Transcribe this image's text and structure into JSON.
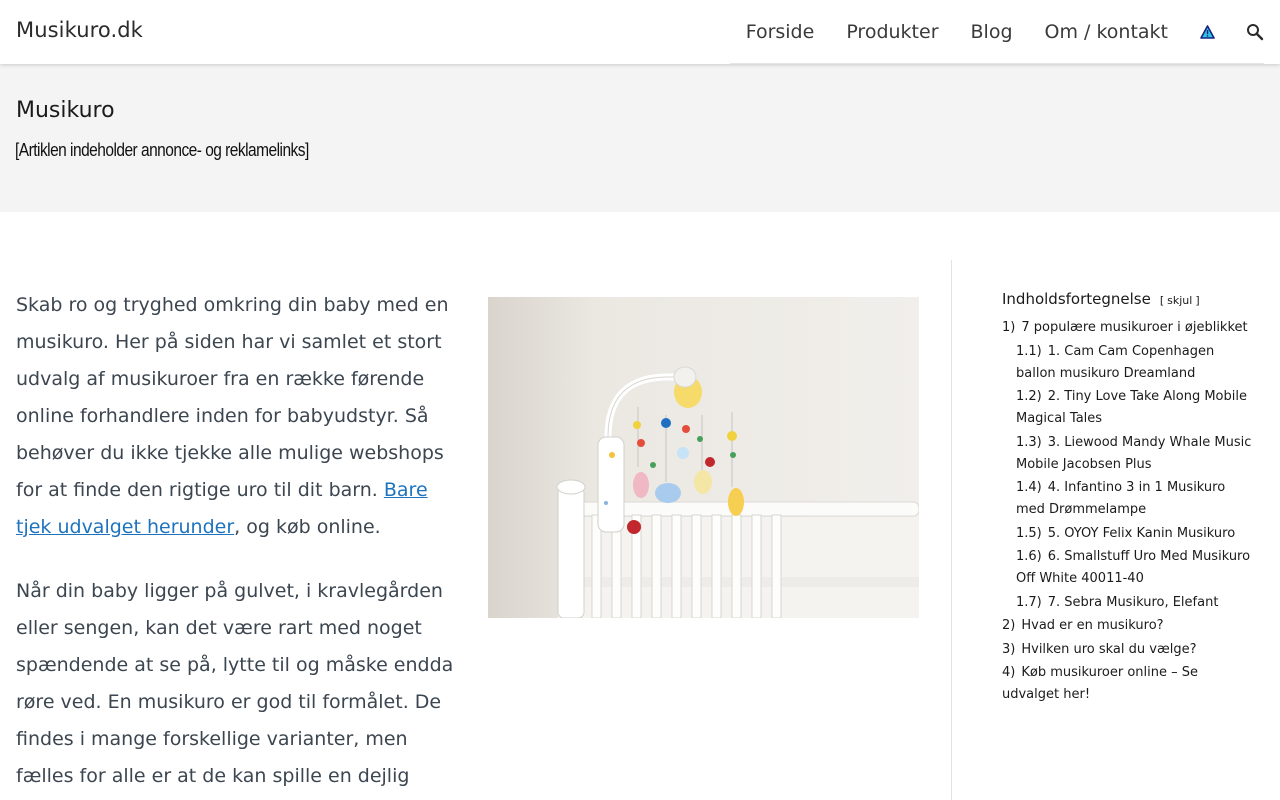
{
  "header": {
    "site_title": "Musikuro.dk",
    "nav": [
      "Forside",
      "Produkter",
      "Blog",
      "Om / kontakt"
    ],
    "icons": [
      "warning-icon",
      "search-icon"
    ]
  },
  "banner": {
    "title": "Musikuro",
    "disclaimer": "[Artiklen indeholder annonce- og reklamelinks]"
  },
  "main": {
    "p1_text": "Skab ro og tryghed omkring din baby med en musikuro. Her på siden har vi samlet et stort udvalg af musikuroer fra en række førende online forhandlere inden for babyudstyr. Så behøver du ikke tjekke alle mulige webshops for at finde den rigtige uro til dit barn. ",
    "p1_link": "Bare tjek udvalget herunder",
    "p1_tail": ", og køb online.",
    "p2_text": "Når din baby ligger på gulvet, i kravlegården eller sengen, kan det være rart med noget spændende at se på, lytte til og måske endda røre ved. En musikuro er god til formålet. De findes i mange forskellige varianter, men fælles for alle er at de kan spille en dejlig"
  },
  "toc": {
    "title": "Indholdsfortegnelse",
    "toggle_open": "[",
    "toggle_label": "skjul",
    "toggle_close": "]",
    "items": [
      {
        "num": "1)",
        "label": "7 populære musikuroer i øjeblikket"
      },
      {
        "num": "1.1)",
        "label": "1. Cam Cam Copenhagen ballon musikuro Dreamland"
      },
      {
        "num": "1.2)",
        "label": "2. Tiny Love Take Along Mobile Magical Tales"
      },
      {
        "num": "1.3)",
        "label": "3. Liewood Mandy Whale Music Mobile Jacobsen Plus"
      },
      {
        "num": "1.4)",
        "label": "4. Infantino 3 in 1 Musikuro med Drømmelampe"
      },
      {
        "num": "1.5)",
        "label": "5. OYOY Felix Kanin Musikuro"
      },
      {
        "num": "1.6)",
        "label": "6. Smallstuff Uro Med Musikuro Off White 40011-40"
      },
      {
        "num": "1.7)",
        "label": "7. Sebra Musikuro, Elefant"
      },
      {
        "num": "2)",
        "label": "Hvad er en musikuro?"
      },
      {
        "num": "3)",
        "label": "Hvilken uro skal du vælge?"
      },
      {
        "num": "4)",
        "label": "Køb musikuroer online – Se udvalget her!"
      }
    ]
  },
  "colors": {
    "link": "#1e73be",
    "band": "#f4f4f4",
    "body_text": "#3c4650"
  }
}
